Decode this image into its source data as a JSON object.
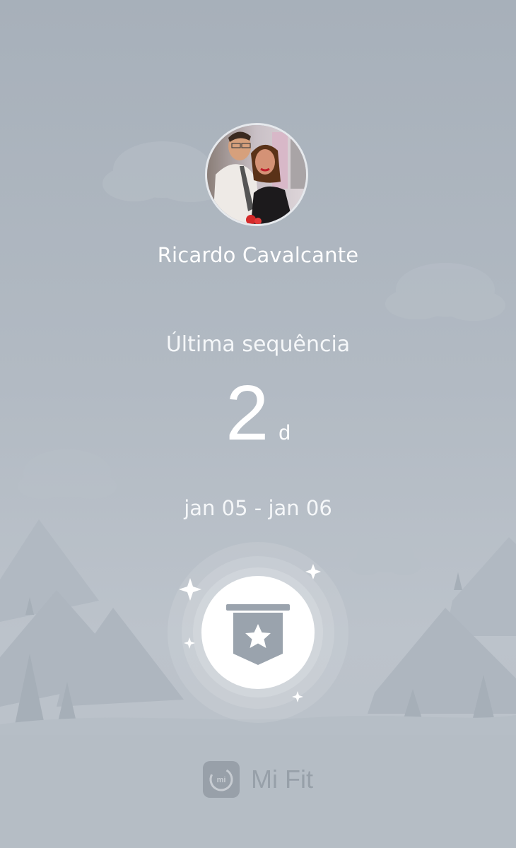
{
  "user": {
    "name": "Ricardo Cavalcante"
  },
  "streak": {
    "label": "Última sequência",
    "value": "2",
    "unit": "d",
    "date_range": "jan 05 - jan 06"
  },
  "badge": {
    "icon": "star-banner-icon"
  },
  "footer": {
    "brand_name": "Mi Fit",
    "logo_text": "mi"
  },
  "colors": {
    "background": "#b2bac3",
    "text": "#ffffff",
    "badge_circle": "#ffffff",
    "badge_icon": "#9aa3ad"
  }
}
